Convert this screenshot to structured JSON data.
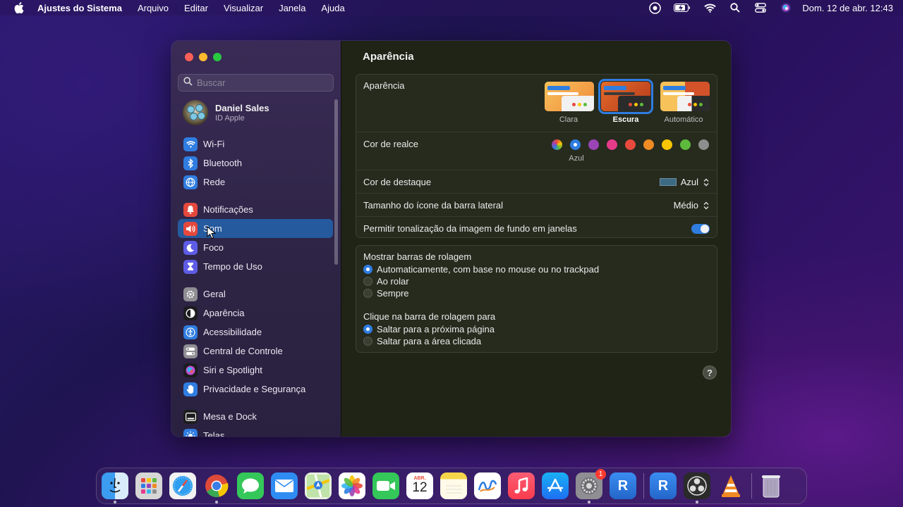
{
  "menubar": {
    "app_name": "Ajustes do Sistema",
    "items": [
      "Arquivo",
      "Editar",
      "Visualizar",
      "Janela",
      "Ajuda"
    ],
    "clock": "Dom. 12 de abr.  12:43",
    "status_icons": [
      "screen-share-icon",
      "battery-charging-icon",
      "wifi-icon",
      "search-icon",
      "control-center-icon",
      "siri-icon"
    ]
  },
  "sidebar": {
    "search_placeholder": "Buscar",
    "profile": {
      "name": "Daniel Sales",
      "subtitle": "ID Apple"
    },
    "items": [
      {
        "label": "Wi-Fi",
        "icon": "wifi-icon",
        "color": "#2f7de1"
      },
      {
        "label": "Bluetooth",
        "icon": "bluetooth-icon",
        "color": "#2f7de1"
      },
      {
        "label": "Rede",
        "icon": "globe-icon",
        "color": "#2f7de1"
      },
      {
        "label": "Notificações",
        "icon": "bell-icon",
        "color": "#e5483d"
      },
      {
        "label": "Som",
        "icon": "speaker-icon",
        "color": "#e5483d",
        "selected": true
      },
      {
        "label": "Foco",
        "icon": "moon-icon",
        "color": "#5e5ce6"
      },
      {
        "label": "Tempo de Uso",
        "icon": "hourglass-icon",
        "color": "#5e5ce6"
      },
      {
        "label": "Geral",
        "icon": "gear-icon",
        "color": "#8e8e93"
      },
      {
        "label": "Aparência",
        "icon": "appearance-icon",
        "color": "#1c1c1e"
      },
      {
        "label": "Acessibilidade",
        "icon": "accessibility-icon",
        "color": "#2f7de1"
      },
      {
        "label": "Central de Controle",
        "icon": "toggles-icon",
        "color": "#8e8e93"
      },
      {
        "label": "Siri e Spotlight",
        "icon": "siri-icon",
        "color": "#1c1c1e"
      },
      {
        "label": "Privacidade e Segurança",
        "icon": "hand-icon",
        "color": "#2f7de1"
      },
      {
        "label": "Mesa e Dock",
        "icon": "dock-icon",
        "color": "#1c1c1e"
      },
      {
        "label": "Telas",
        "icon": "sun-icon",
        "color": "#2f7de1"
      }
    ]
  },
  "main": {
    "title": "Aparência",
    "appearance": {
      "label": "Aparência",
      "options": [
        {
          "label": "Clara",
          "selected": false
        },
        {
          "label": "Escura",
          "selected": true
        },
        {
          "label": "Automático",
          "selected": false
        }
      ]
    },
    "accent": {
      "label": "Cor de realce",
      "selected_name": "Azul",
      "colors": [
        "multicolor",
        "#2f7de1",
        "#9b44b5",
        "#e63a8a",
        "#e84a3d",
        "#f08a24",
        "#f7c600",
        "#5dba3c",
        "#8e8e8e"
      ],
      "selected_index": 1
    },
    "highlight": {
      "label": "Cor de destaque",
      "value": "Azul",
      "swatch": "#3d6a83"
    },
    "sidebar_icon_size": {
      "label": "Tamanho do ícone da barra lateral",
      "value": "Médio"
    },
    "wallpaper_tinting": {
      "label": "Permitir tonalização da imagem de fundo em janelas",
      "on": true
    },
    "scrollbars": {
      "title": "Mostrar barras de rolagem",
      "options": [
        {
          "label": "Automaticamente, com base no mouse ou no trackpad",
          "selected": true
        },
        {
          "label": "Ao rolar",
          "selected": false
        },
        {
          "label": "Sempre",
          "selected": false
        }
      ]
    },
    "click_scrollbar": {
      "title": "Clique na barra de rolagem para",
      "options": [
        {
          "label": "Saltar para a próxima página",
          "selected": true
        },
        {
          "label": "Saltar para a área clicada",
          "selected": false
        }
      ]
    },
    "help_label": "?"
  },
  "dock": {
    "apps": [
      {
        "name": "Finder",
        "icon": "finder-icon",
        "running": true
      },
      {
        "name": "Launchpad",
        "icon": "launchpad-icon",
        "running": false
      },
      {
        "name": "Safari",
        "icon": "safari-icon",
        "running": false
      },
      {
        "name": "Google Chrome",
        "icon": "chrome-icon",
        "running": true
      },
      {
        "name": "Mensagens",
        "icon": "messages-icon",
        "running": false
      },
      {
        "name": "Mail",
        "icon": "mail-icon",
        "running": false
      },
      {
        "name": "Mapas",
        "icon": "maps-icon",
        "running": false
      },
      {
        "name": "Fotos",
        "icon": "photos-icon",
        "running": false
      },
      {
        "name": "FaceTime",
        "icon": "facetime-icon",
        "running": false
      },
      {
        "name": "Calendário",
        "icon": "calendar-icon",
        "running": false,
        "month": "ABR.",
        "day": "12"
      },
      {
        "name": "Notas",
        "icon": "notes-icon",
        "running": false
      },
      {
        "name": "Freeform",
        "icon": "freeform-icon",
        "running": false
      },
      {
        "name": "Música",
        "icon": "music-icon",
        "running": false
      },
      {
        "name": "App Store",
        "icon": "appstore-icon",
        "running": false
      },
      {
        "name": "Ajustes do Sistema",
        "icon": "settings-icon",
        "running": true,
        "badge": "1"
      },
      {
        "name": "Remote Desktop",
        "icon": "remote-icon",
        "running": false
      }
    ],
    "recent": [
      {
        "name": "Remote Desktop",
        "icon": "remote-icon",
        "running": false
      },
      {
        "name": "OBS",
        "icon": "obs-icon",
        "running": true
      },
      {
        "name": "VLC",
        "icon": "vlc-icon",
        "running": false
      }
    ],
    "trash": {
      "name": "Lixo",
      "icon": "trash-icon"
    }
  }
}
